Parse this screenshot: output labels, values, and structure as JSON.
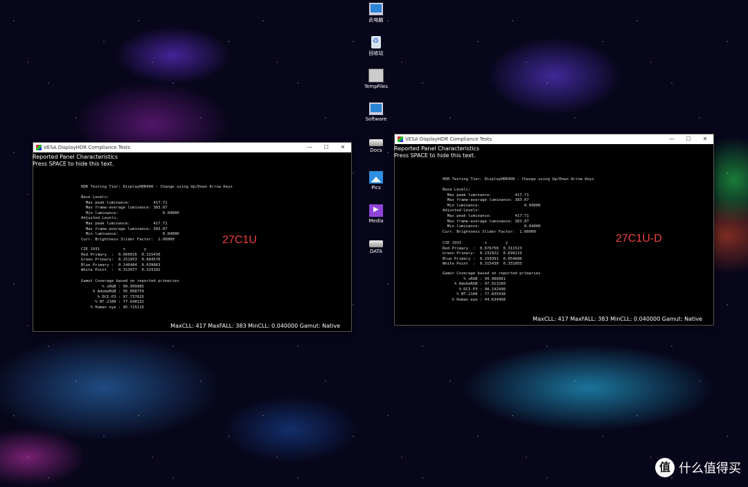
{
  "desktop_icons": [
    {
      "label": "此电脑",
      "icon": "monitor-icon"
    },
    {
      "label": "回收站",
      "icon": "recycle-bin-icon"
    },
    {
      "label": "TempFiles",
      "icon": "folder-icon"
    },
    {
      "label": "Software",
      "icon": "monitor-icon"
    },
    {
      "label": "Docs",
      "icon": "drive-icon"
    },
    {
      "label": "Pics",
      "icon": "pictures-icon"
    },
    {
      "label": "Media",
      "icon": "media-icon"
    },
    {
      "label": "DATA",
      "icon": "drive-icon"
    }
  ],
  "window_left": {
    "title": "VESA DisplayHDR Compliance Tests",
    "controls": {
      "minimize": "—",
      "maximize": "☐",
      "close": "✕"
    },
    "notice_line1": "Reported Panel Characteristics",
    "notice_line2": "Press SPACE to hide this text.",
    "monitor_label": "27C1U",
    "tier_line": "HDR Testing Tier: DisplayHDR400 - Change using Up/Down Arrow Keys",
    "levels": "Base Levels:\n  Max peak luminance:          417.71\n  Max frame-average luminance: 383.07\n  Min luminance:                   0.04000\nAdjusted Levels:\n  Max peak luminance:          417.71\n  Max frame-average luminance: 383.07\n  Min luminance:                   0.04000\nCurr. Brightness Slider Factor:  1.00000",
    "cie": "CIE 1931          x        y\nRed Primary  :  0.666016  0.315430\nGreen Primary:  0.251953  0.684570\nBlue Primary :  0.146484  0.039063\nWhite Point  :  0.313477  0.329102",
    "gamut": "Gamut Coverage based on reported primaries\n         % sRGB : 99.999985\n     % AdobeRGB : 95.008759\n       % DCI-P3 : 97.737625\n      % BT.2100 : 77.648132\n    % Human eye : 45.715115",
    "status": "MaxCLL: 417  MaxFALL: 383  MinCLL: 0.040000  Gamut: Native"
  },
  "window_right": {
    "title": "VESA DisplayHDR Compliance Tests",
    "controls": {
      "minimize": "—",
      "maximize": "☐",
      "close": "✕"
    },
    "notice_line1": "Reported Panel Characteristics",
    "notice_line2": "Press SPACE to hide this text.",
    "monitor_label": "27C1U-D",
    "tier_line": "HDR Testing Tier: DisplayHDR400 - Change using Up/Down Arrow Keys",
    "levels": "Base Levels:\n  Max peak luminance:          417.71\n  Max frame-average luminance: 383.07\n  Min luminance:                   0.04000\nAdjusted Levels:\n  Max peak luminance:          417.71\n  Max frame-average luminance: 383.07\n  Min luminance:                   0.04000\nCurr. Brightness Slider Factor:  1.00000",
    "cie": "CIE 1931          x        y\nRed Primary  :  0.676758  0.311523\nGreen Primary:  0.232422  0.699219\nBlue Primary :  0.150391  0.054688\nWhite Point  :  0.315430  0.331055",
    "gamut": "Gamut Coverage based on reported primaries\n         % sRGB : 99.986061\n     % AdobeRGB : 97.013260\n       % DCI-P3 : 98.142990\n      % BT.2100 : 77.835938\n    % Human eye : 44.634968",
    "status": "MaxCLL: 417  MaxFALL: 383  MinCLL: 0.040000  Gamut: Native"
  },
  "watermark": {
    "badge": "值",
    "text": "什么值得买"
  }
}
